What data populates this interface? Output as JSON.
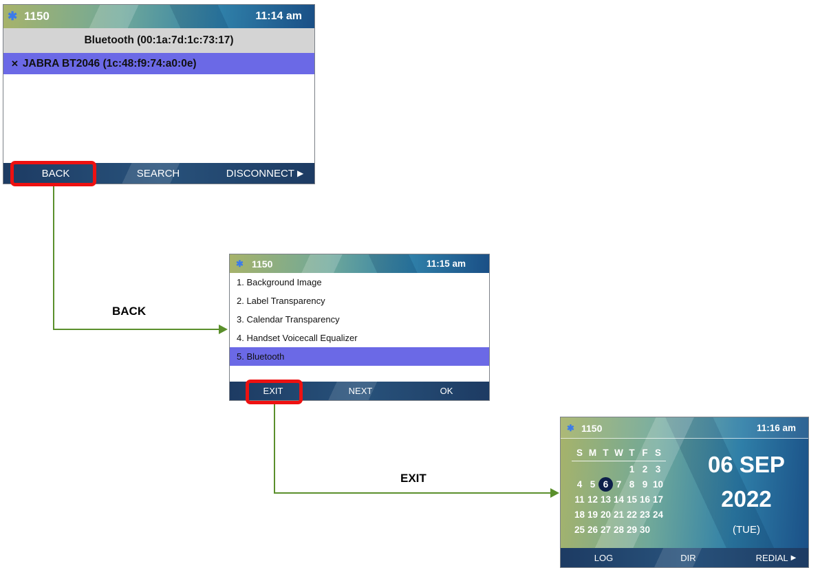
{
  "screen1": {
    "extension": "1150",
    "time": "11:14 am",
    "header": "Bluetooth (00:1a:7d:1c:73:17)",
    "device_item": "JABRA BT2046 (1c:48:f9:74:a0:0e)",
    "softkeys": {
      "left": "BACK",
      "center": "SEARCH",
      "right": "DISCONNECT"
    }
  },
  "screen2": {
    "extension": "1150",
    "time": "11:15 am",
    "menu": [
      "1. Background Image",
      "2. Label Transparency",
      "3. Calendar Transparency",
      "4. Handset Voicecall Equalizer",
      "5. Bluetooth"
    ],
    "softkeys": {
      "left": "EXIT",
      "center": "NEXT",
      "right": "OK"
    }
  },
  "screen3": {
    "extension": "1150",
    "time": "11:16 am",
    "weekdays": [
      "S",
      "M",
      "T",
      "W",
      "T",
      "F",
      "S"
    ],
    "weeks": [
      [
        "",
        "",
        "",
        "",
        "1",
        "2",
        "3"
      ],
      [
        "4",
        "5",
        "6",
        "7",
        "8",
        "9",
        "10"
      ],
      [
        "11",
        "12",
        "13",
        "14",
        "15",
        "16",
        "17"
      ],
      [
        "18",
        "19",
        "20",
        "21",
        "22",
        "23",
        "24"
      ],
      [
        "25",
        "26",
        "27",
        "28",
        "29",
        "30",
        ""
      ]
    ],
    "date": "06 SEP",
    "year": "2022",
    "weekday": "(TUE)",
    "softkeys": {
      "left": "LOG",
      "center": "DIR",
      "right": "REDIAL"
    }
  },
  "flow": {
    "label1": "BACK",
    "label2": "EXIT"
  },
  "colors": {
    "selection": "#6b69e6",
    "highlight": "#ee1111",
    "arrow": "#5a8f2b",
    "bluetooth_icon": "#3b7bea"
  },
  "icons": {
    "status": "bluetooth-icon",
    "device": "bluetooth-audio-icon",
    "softkey_more": "triangle-right-icon"
  }
}
